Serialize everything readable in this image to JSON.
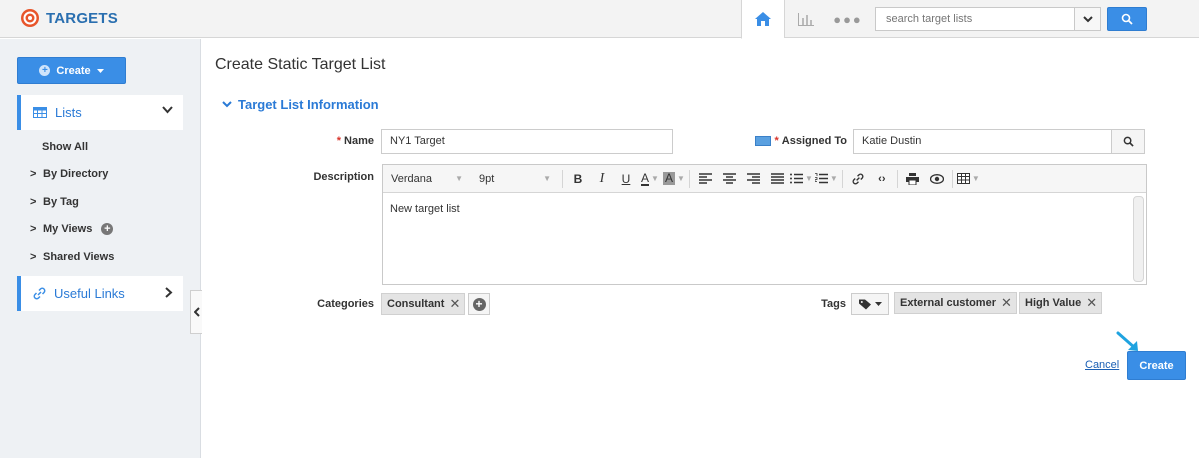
{
  "app": {
    "name": "TARGETS"
  },
  "topnav": {
    "search_placeholder": "search target lists"
  },
  "sidebar": {
    "create_label": "Create",
    "lists_label": "Lists",
    "items": [
      {
        "label": "Show All"
      },
      {
        "label": "By Directory"
      },
      {
        "label": "By Tag"
      },
      {
        "label": "My Views"
      },
      {
        "label": "Shared Views"
      }
    ],
    "useful_links_label": "Useful Links"
  },
  "main": {
    "page_title": "Create Static Target List",
    "section_title": "Target List Information",
    "name_label": "Name",
    "name_value": "NY1 Target",
    "assigned_label": "Assigned To",
    "assigned_value": "Katie Dustin",
    "description_label": "Description",
    "editor": {
      "font_family": "Verdana",
      "font_size": "9pt",
      "content": "New target list"
    },
    "categories_label": "Categories",
    "categories": [
      "Consultant"
    ],
    "tags_label": "Tags",
    "tags": [
      "External customer",
      "High Value"
    ],
    "cancel_label": "Cancel",
    "submit_label": "Create"
  },
  "colors": {
    "accent": "#3a8ee6",
    "link": "#2a7ad6",
    "required": "#d9342b"
  }
}
